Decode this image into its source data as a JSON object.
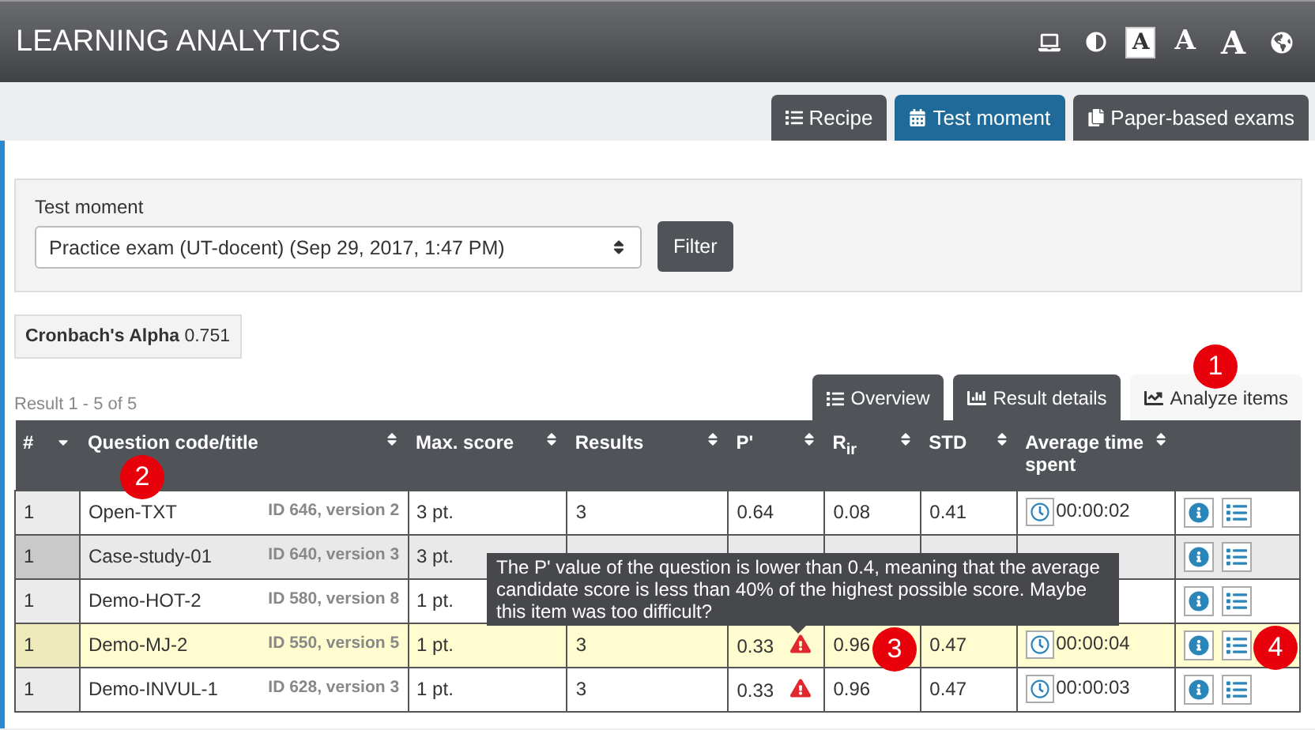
{
  "header": {
    "title": "LEARNING ANALYTICS",
    "tools": [
      {
        "kind": "laptop",
        "selected": false
      },
      {
        "kind": "contrast",
        "selected": false
      },
      {
        "kind": "letter_small",
        "label": "A",
        "selected": true
      },
      {
        "kind": "letter_medium",
        "label": "A",
        "selected": false
      },
      {
        "kind": "letter_large",
        "label": "A",
        "selected": false
      },
      {
        "kind": "globe",
        "selected": false
      }
    ]
  },
  "main_tabs": [
    {
      "label": "Recipe",
      "selected": false
    },
    {
      "label": "Test moment",
      "selected": true
    },
    {
      "label": "Paper-based exams",
      "selected": false
    }
  ],
  "filter": {
    "label": "Test moment",
    "select_value": "Practice exam (UT-docent) (Sep 29, 2017, 1:47 PM)",
    "button": "Filter"
  },
  "cronbach": {
    "label": "Cronbach's Alpha",
    "value": "0.751"
  },
  "result_count": "Result 1 - 5 of 5",
  "view_tabs": [
    {
      "label": "Overview",
      "selected": false
    },
    {
      "label": "Result details",
      "selected": false
    },
    {
      "label": "Analyze items",
      "selected": true
    }
  ],
  "table": {
    "columns": [
      "#",
      "Question code/title",
      "Max. score",
      "Results",
      "P'",
      "R$_{ir}$",
      "STD",
      "Average time spent"
    ],
    "rows": [
      {
        "num": "1",
        "title": "Open-TXT",
        "id": "ID 646, version 2",
        "max": "3 pt.",
        "results": "3",
        "p": "0.64",
        "warning": false,
        "rir": "0.08",
        "std": "0.41",
        "time": "00:00:02",
        "selected": false,
        "hovered": false
      },
      {
        "num": "1",
        "title": "Case-study-01",
        "id": "ID 640, version 3",
        "max": "3 pt.",
        "selected": false,
        "hovered": true
      },
      {
        "num": "1",
        "title": "Demo-HOT-2",
        "id": "ID 580, version 8",
        "max": "1 pt.",
        "selected": false,
        "hovered": false
      },
      {
        "num": "1",
        "title": "Demo-MJ-2",
        "id": "ID 550, version 5",
        "max": "1 pt.",
        "results": "3",
        "p": "0.33",
        "warning": true,
        "rir": "0.96",
        "std": "0.47",
        "time": "00:00:04",
        "selected": true,
        "hovered": false
      },
      {
        "num": "1",
        "title": "Demo-INVUL-1",
        "id": "ID 628, version 3",
        "max": "1 pt.",
        "results": "3",
        "p": "0.33",
        "warning": true,
        "rir": "0.96",
        "std": "0.47",
        "time": "00:00:03",
        "selected": false,
        "hovered": false
      }
    ]
  },
  "tooltip": "The P' value of the question is lower than 0.4, meaning that the average candidate score is less than 40% of the highest possible score. Maybe this item was too difficult?",
  "callouts": [
    "1",
    "2",
    "3",
    "4"
  ]
}
